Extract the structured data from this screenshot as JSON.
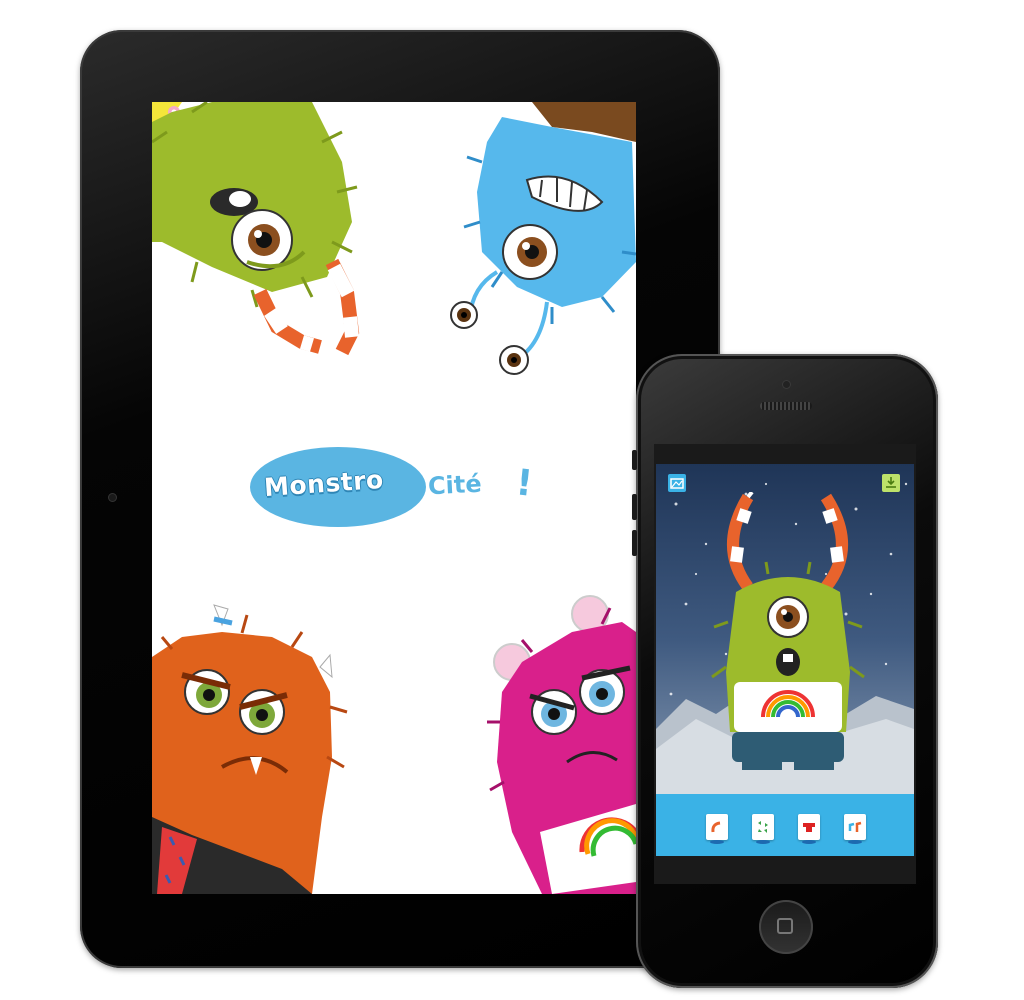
{
  "app": {
    "logo": {
      "word1": "Monstro",
      "word2": "Cité",
      "exclaim": "!"
    }
  },
  "colors": {
    "brand_blue": "#5ab5e2",
    "monster_green": "#9dbb2c",
    "monster_blue": "#56b8ec",
    "monster_orange": "#e0621c",
    "monster_pink": "#d9208b",
    "water": "#3ab2e6"
  },
  "game_screen": {
    "toolbar": {
      "left_icon": "gallery-icon",
      "right_icon": "download-icon"
    },
    "tools": [
      {
        "icon": "horns-icon"
      },
      {
        "icon": "pattern-icon"
      },
      {
        "icon": "shirt-icon"
      },
      {
        "icon": "arms-icon"
      }
    ]
  }
}
